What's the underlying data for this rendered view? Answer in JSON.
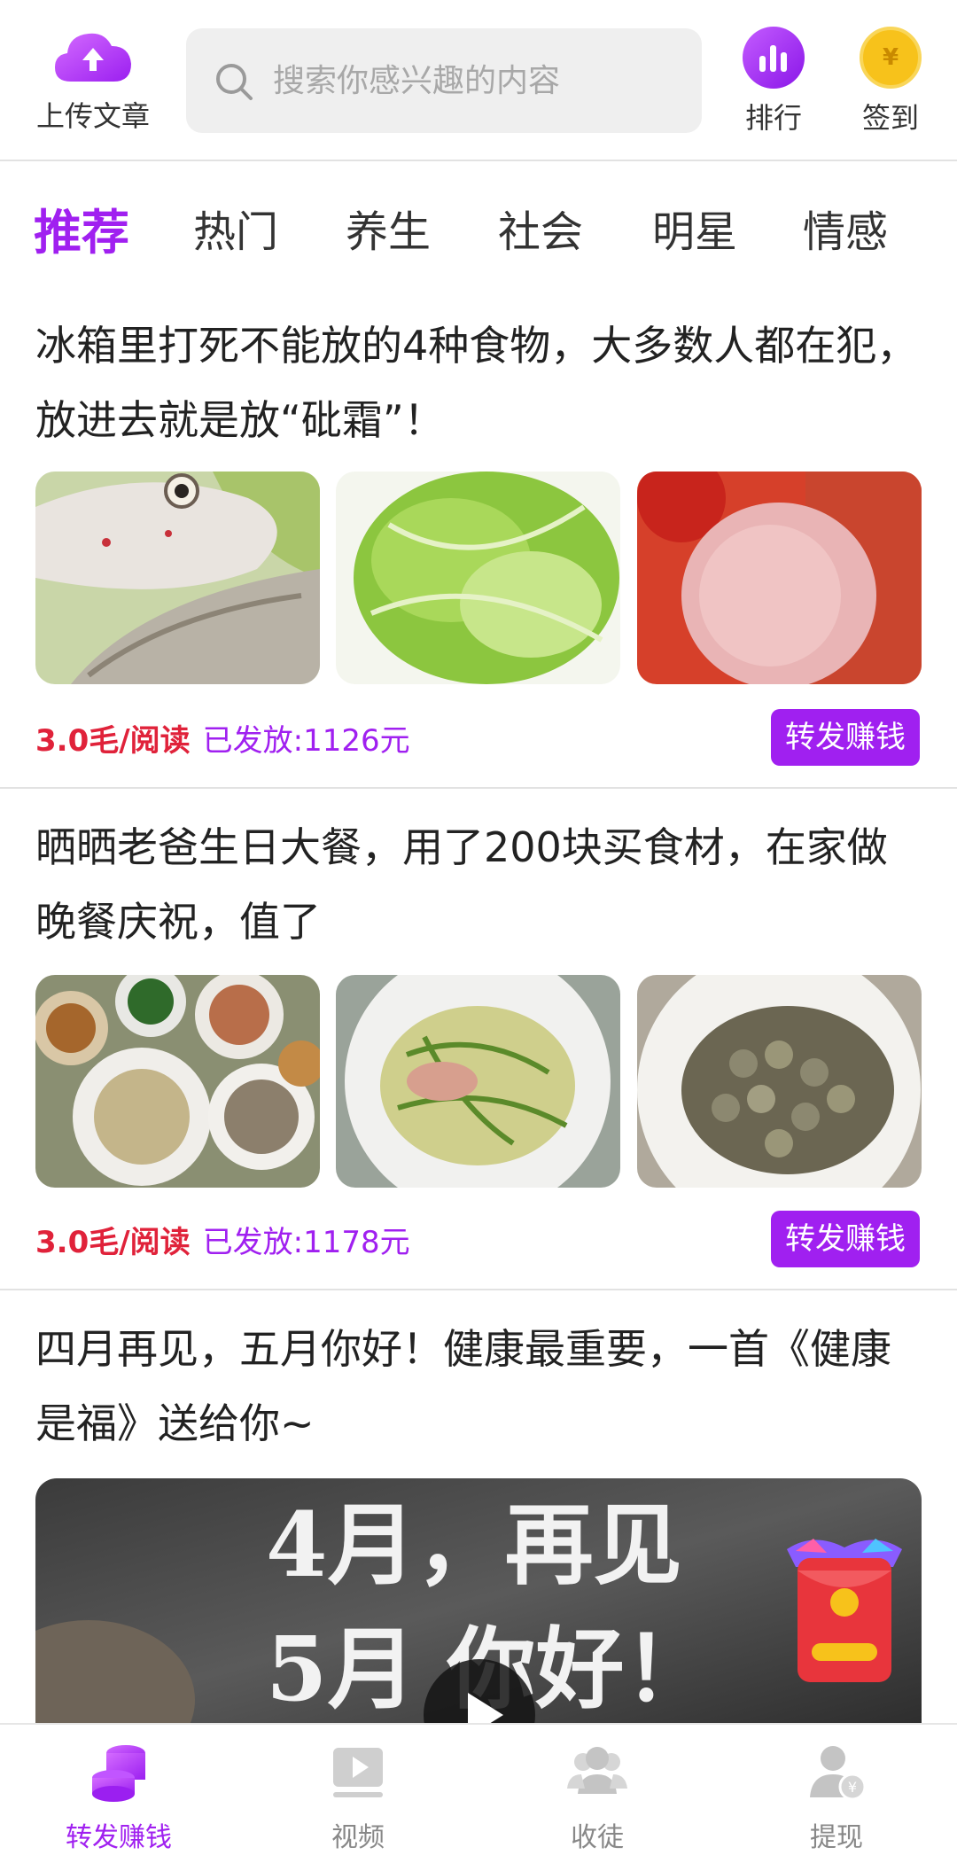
{
  "header": {
    "upload_label": "上传文章",
    "search_placeholder": "搜索你感兴趣的内容",
    "rank_label": "排行",
    "signin_label": "签到",
    "signin_glyph": "¥"
  },
  "tabs": [
    {
      "label": "推荐",
      "active": true
    },
    {
      "label": "热门",
      "active": false
    },
    {
      "label": "养生",
      "active": false
    },
    {
      "label": "社会",
      "active": false
    },
    {
      "label": "明星",
      "active": false
    },
    {
      "label": "情感",
      "active": false
    }
  ],
  "articles": [
    {
      "title": "冰箱里打死不能放的4种食物，大多数人都在犯，放进去就是放“砒霜”！",
      "rate": "3.0毛/阅读",
      "paid": "已发放:1126元",
      "share_label": "转发赚钱",
      "images": [
        "fish-image",
        "lettuce-image",
        "ham-sausage-image"
      ]
    },
    {
      "title": "晒晒老爸生日大餐，用了200块买食材，在家做晚餐庆祝，值了",
      "rate": "3.0毛/阅读",
      "paid": "已发放:1178元",
      "share_label": "转发赚钱",
      "images": [
        "dinner-table-image",
        "stir-fry-dish-image",
        "snails-bowl-image"
      ]
    },
    {
      "title": "四月再见，五月你好！健康最重要，一首《健康是福》送给你~",
      "video_text_line1": "4月，再见",
      "video_text_line2": "5月 你好！"
    }
  ],
  "bottom_nav": [
    {
      "label": "转发赚钱",
      "icon": "coins-icon",
      "active": true
    },
    {
      "label": "视频",
      "icon": "video-icon",
      "active": false
    },
    {
      "label": "收徒",
      "icon": "people-icon",
      "active": false
    },
    {
      "label": "提现",
      "icon": "withdraw-icon",
      "active": false
    }
  ],
  "colors": {
    "accent": "#a020f0",
    "rate_red": "#e0223a",
    "signin_gold": "#f7c21b"
  }
}
